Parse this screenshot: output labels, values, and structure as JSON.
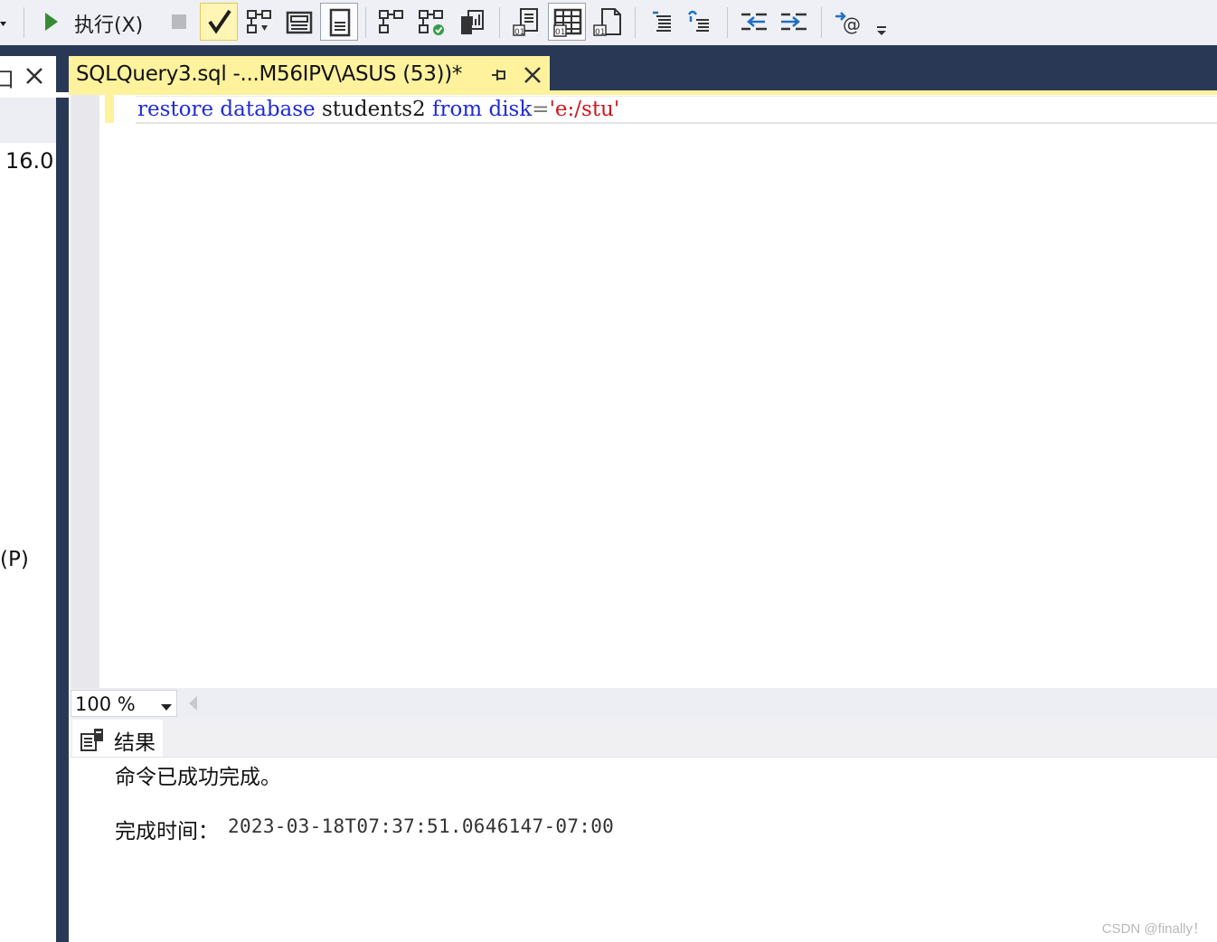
{
  "toolbar": {
    "execute_label": "执行(X)",
    "icons": [
      "dropdown-arrow-icon",
      "execute-icon",
      "stop-icon",
      "parse-check-icon",
      "display-plan-icon",
      "query-designer-icon",
      "results-to-text-icon",
      "results-to-grid-icon",
      "results-to-file-icon",
      "include-plan-icon",
      "live-stats-icon",
      "client-stats-icon",
      "comment-icon",
      "uncomment-icon",
      "outdent-icon",
      "indent-icon",
      "specify-template-values-icon",
      "toolbar-overflow-icon"
    ]
  },
  "left_panel": {
    "pin_glyph": "口",
    "text_line_1": "16.0.",
    "text_line_2": "(P)"
  },
  "document_tab": {
    "title": "SQLQuery3.sql -...M56IPV\\ASUS (53))*"
  },
  "editor": {
    "tokens": [
      {
        "text": "restore",
        "kind": "keyword"
      },
      {
        "text": " ",
        "kind": "plain"
      },
      {
        "text": "database",
        "kind": "keyword"
      },
      {
        "text": " students2 ",
        "kind": "plain"
      },
      {
        "text": "from",
        "kind": "keyword"
      },
      {
        "text": " ",
        "kind": "plain"
      },
      {
        "text": "disk",
        "kind": "keyword"
      },
      {
        "text": "=",
        "kind": "plain-gray"
      },
      {
        "text": "'e:/stu'",
        "kind": "string"
      }
    ]
  },
  "zoom": {
    "value": "100 %"
  },
  "results": {
    "tab_label": "结果",
    "message_line": "命令已成功完成。",
    "completion_label": "完成时间：",
    "completion_time": "2023-03-18T07:37:51.0646147-07:00"
  },
  "watermark": "CSDN @finally！",
  "colors": {
    "keyword": "#1f2bd6",
    "string": "#d0161b",
    "tab_active": "#fff29d",
    "frame": "#293955"
  }
}
